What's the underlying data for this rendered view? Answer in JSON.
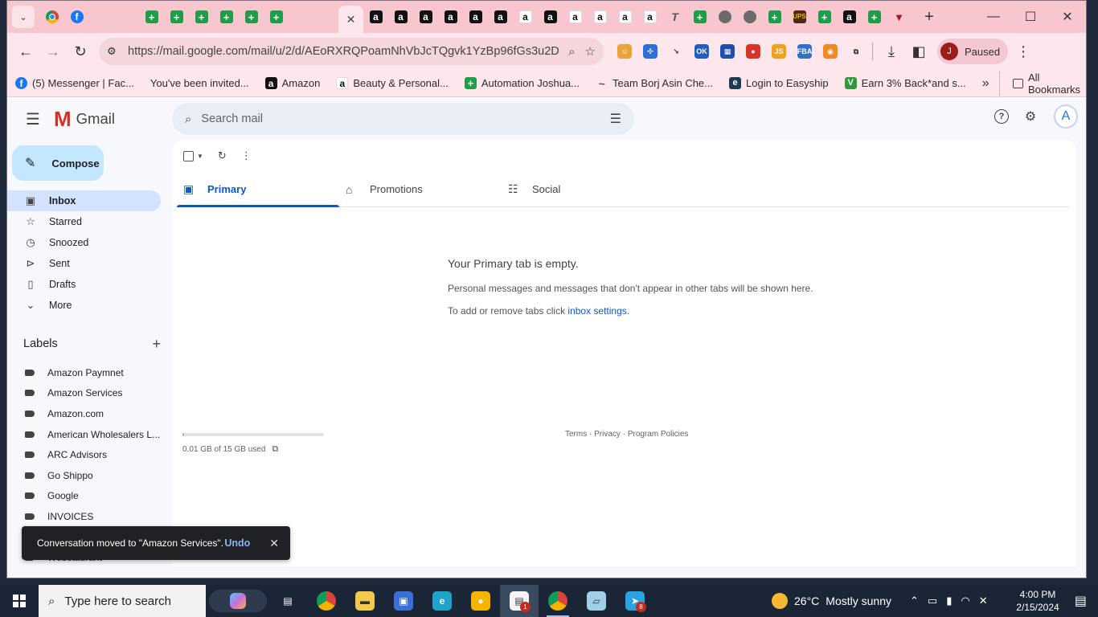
{
  "browser": {
    "tabs": [
      {
        "icon": "chrome",
        "glyph": ""
      },
      {
        "icon": "fb",
        "glyph": "f"
      },
      {
        "icon": "gmail",
        "glyph": "M"
      },
      {
        "icon": "gmail",
        "glyph": "M"
      },
      {
        "icon": "sheet",
        "glyph": "+"
      },
      {
        "icon": "sheet",
        "glyph": "+"
      },
      {
        "icon": "sheet",
        "glyph": "+"
      },
      {
        "icon": "sheet",
        "glyph": "+"
      },
      {
        "icon": "sheet",
        "glyph": "+"
      },
      {
        "icon": "sheet",
        "glyph": "+"
      },
      {
        "icon": "gmail",
        "glyph": "M"
      },
      {
        "icon": "gmail",
        "glyph": "M"
      },
      {
        "icon": "close",
        "glyph": "✕",
        "active": true
      },
      {
        "icon": "amz",
        "glyph": "a"
      },
      {
        "icon": "amz",
        "glyph": "a"
      },
      {
        "icon": "amz",
        "glyph": "a"
      },
      {
        "icon": "amz",
        "glyph": "a"
      },
      {
        "icon": "amz",
        "glyph": "a"
      },
      {
        "icon": "amz",
        "glyph": "a"
      },
      {
        "icon": "amzl",
        "glyph": "a"
      },
      {
        "icon": "amz",
        "glyph": "a"
      },
      {
        "icon": "amzl",
        "glyph": "a"
      },
      {
        "icon": "amzl",
        "glyph": "a"
      },
      {
        "icon": "amzl",
        "glyph": "a"
      },
      {
        "icon": "amzl",
        "glyph": "a"
      },
      {
        "icon": "t",
        "glyph": "T"
      },
      {
        "icon": "sheet",
        "glyph": "+"
      },
      {
        "icon": "globe",
        "glyph": ""
      },
      {
        "icon": "globe",
        "glyph": ""
      },
      {
        "icon": "sheet",
        "glyph": "+"
      },
      {
        "icon": "ups",
        "glyph": "UPS"
      },
      {
        "icon": "sheet",
        "glyph": "+"
      },
      {
        "icon": "amz",
        "glyph": "a"
      },
      {
        "icon": "sheet",
        "glyph": "+"
      },
      {
        "icon": "pin",
        "glyph": "▼"
      }
    ],
    "url": "https://mail.google.com/mail/u/2/d/AEoRXRQPoamNhVbJcTQgvk1YzBp96fGs3u2D...",
    "profile_initial": "J",
    "profile_status": "Paused",
    "bookmarks": [
      {
        "icon": "fb",
        "glyph": "f",
        "label": "(5) Messenger | Fac..."
      },
      {
        "icon": "gmail",
        "glyph": "M",
        "label": "You've been invited..."
      },
      {
        "icon": "amz",
        "glyph": "a",
        "label": "Amazon"
      },
      {
        "icon": "amzl",
        "glyph": "a",
        "label": "Beauty & Personal..."
      },
      {
        "icon": "sheet",
        "glyph": "+",
        "label": "Automation Joshua..."
      },
      {
        "icon": "t",
        "glyph": "~",
        "label": "Team Borj Asin Che..."
      },
      {
        "icon": "easyship",
        "glyph": "e",
        "label": "Login to Easyship"
      },
      {
        "icon": "cashback",
        "glyph": "V",
        "label": "Earn 3% Back*and s..."
      }
    ],
    "all_bookmarks_label": "All Bookmarks",
    "extensions": [
      {
        "bg": "#e8a33b",
        "glyph": "☺"
      },
      {
        "bg": "#2d6fd6",
        "glyph": "✣"
      },
      {
        "bg": "transparent",
        "glyph": "↘"
      },
      {
        "bg": "#1f5fbf",
        "glyph": "OK"
      },
      {
        "bg": "#1f4fa8",
        "glyph": "▦"
      },
      {
        "bg": "#d8342a",
        "glyph": "●"
      },
      {
        "bg": "#f0a020",
        "glyph": "JS"
      },
      {
        "bg": "#3070c8",
        "glyph": "FBA"
      },
      {
        "bg": "#f08a24",
        "glyph": "◉"
      },
      {
        "bg": "transparent",
        "glyph": "⧉"
      }
    ]
  },
  "gmail": {
    "logo_text": "Gmail",
    "search_placeholder": "Search mail",
    "account_initial": "A",
    "compose_label": "Compose",
    "nav": [
      {
        "name": "inbox",
        "icon": "▣",
        "label": "Inbox",
        "active": true
      },
      {
        "name": "starred",
        "icon": "☆",
        "label": "Starred"
      },
      {
        "name": "snoozed",
        "icon": "◷",
        "label": "Snoozed"
      },
      {
        "name": "sent",
        "icon": "⊳",
        "label": "Sent"
      },
      {
        "name": "drafts",
        "icon": "▯",
        "label": "Drafts"
      },
      {
        "name": "more",
        "icon": "⌄",
        "label": "More"
      }
    ],
    "labels_title": "Labels",
    "labels": [
      "Amazon Paymnet",
      "Amazon Services",
      "Amazon.com",
      "American Wholesalers L...",
      "ARC Advisors",
      "Go Shippo",
      "Google",
      "INVOICES",
      "Si  M    i",
      "Webstaurant"
    ],
    "category_tabs": [
      {
        "name": "primary",
        "icon": "▣",
        "label": "Primary",
        "active": true
      },
      {
        "name": "promotions",
        "icon": "⌂",
        "label": "Promotions"
      },
      {
        "name": "social",
        "icon": "☷",
        "label": "Social"
      }
    ],
    "empty_title": "Your Primary tab is empty.",
    "empty_line1": "Personal messages and messages that don't appear in other tabs will be shown here.",
    "empty_line2_prefix": "To add or remove tabs click ",
    "empty_line2_link": "inbox settings",
    "empty_line2_suffix": ".",
    "storage_text": "0.01 GB of 15 GB used",
    "storage_fraction": 0.001,
    "footer_links": [
      "Terms",
      "Privacy",
      "Program Policies"
    ],
    "snackbar_text": "Conversation moved to \"Amazon Services\".",
    "snackbar_undo": "Undo"
  },
  "taskbar": {
    "search_placeholder": "Type here to search",
    "apps": [
      {
        "name": "task-view",
        "glyph": "▤",
        "bg": "transparent"
      },
      {
        "name": "chrome",
        "glyph": "",
        "bg": "chrome"
      },
      {
        "name": "file-explorer",
        "glyph": "▬",
        "bg": "#f2c94c"
      },
      {
        "name": "remote-desktop",
        "glyph": "▣",
        "bg": "#3b6fd8"
      },
      {
        "name": "edge",
        "glyph": "e",
        "bg": "#1fa3c9"
      },
      {
        "name": "vpn",
        "glyph": "●",
        "bg": "#f4b400"
      },
      {
        "name": "notes",
        "glyph": "▤",
        "bg": "#f5f5f5",
        "badge": "1",
        "active": true
      },
      {
        "name": "chrome-profile",
        "glyph": "",
        "bg": "chrome",
        "open": true
      },
      {
        "name": "notepad",
        "glyph": "▱",
        "bg": "#9fd0e8"
      },
      {
        "name": "telegram",
        "glyph": "➤",
        "bg": "#2aa3e0",
        "badge": "8"
      }
    ],
    "weather_temp": "26°C",
    "weather_text": "Mostly sunny",
    "time": "4:00 PM",
    "date": "2/15/2024"
  }
}
